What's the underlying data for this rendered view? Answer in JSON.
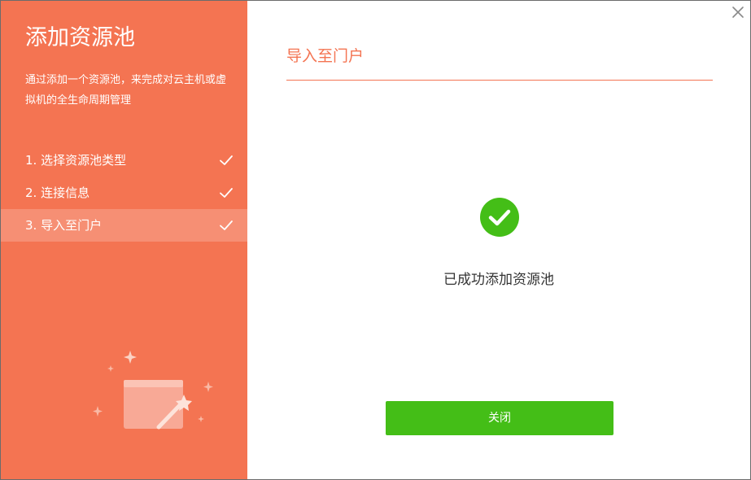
{
  "dialog": {
    "left": {
      "title": "添加资源池",
      "description": "通过添加一个资源池，来完成对云主机或虚拟机的全生命周期管理",
      "steps": [
        {
          "label": "1. 选择资源池类型",
          "completed": true,
          "active": false
        },
        {
          "label": "2. 连接信息",
          "completed": true,
          "active": false
        },
        {
          "label": "3. 导入至门户",
          "completed": true,
          "active": true
        }
      ]
    },
    "right": {
      "section_title": "导入至门户",
      "success_message": "已成功添加资源池",
      "close_button_label": "关闭"
    },
    "close_icon": "close-icon",
    "colors": {
      "accent": "#f47452",
      "success": "#44be17",
      "text": "#333333"
    }
  }
}
